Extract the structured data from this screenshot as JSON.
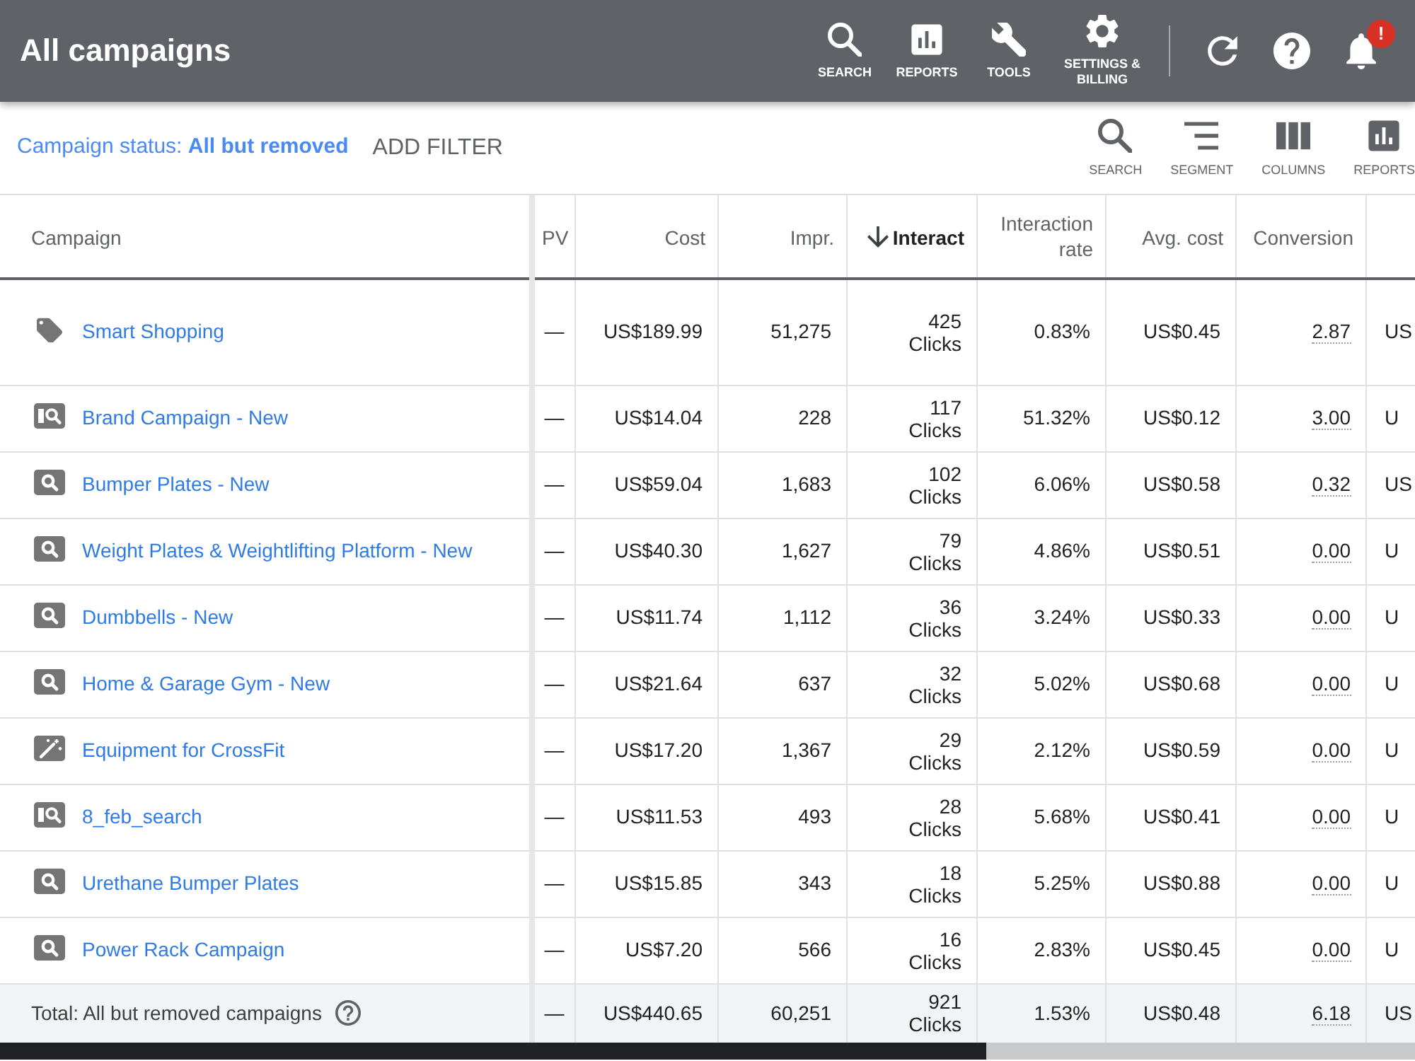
{
  "header": {
    "title": "All campaigns",
    "tools": [
      {
        "kind": "search",
        "label": "SEARCH"
      },
      {
        "kind": "reports",
        "label": "REPORTS"
      },
      {
        "kind": "tools",
        "label": "TOOLS"
      },
      {
        "kind": "settings",
        "label": "SETTINGS & BILLING"
      }
    ],
    "actions": [
      {
        "kind": "refresh"
      },
      {
        "kind": "help"
      },
      {
        "kind": "notifications",
        "badge": "!"
      }
    ]
  },
  "filter_bar": {
    "status_filter": "Campaign status: **All but removed**",
    "add_filter": "ADD FILTER",
    "tools": [
      {
        "kind": "search",
        "label": "SEARCH"
      },
      {
        "kind": "segment",
        "label": "SEGMENT"
      },
      {
        "kind": "columns",
        "label": "COLUMNS"
      },
      {
        "kind": "reports",
        "label": "REPORTS"
      }
    ]
  },
  "table": {
    "columns": [
      {
        "label": "Campaign",
        "sorted": false
      },
      {
        "label": "PV",
        "sorted": false
      },
      {
        "label": "Cost",
        "sorted": false
      },
      {
        "label": "Impr.",
        "sorted": false
      },
      {
        "label": "Interact",
        "sorted": true
      },
      {
        "label": "Interaction rate",
        "sorted": false
      },
      {
        "label": "Avg. cost",
        "sorted": false
      },
      {
        "label": "Conversion",
        "sorted": false
      }
    ],
    "rows": [
      {
        "kind": "shopping",
        "campaign": "Smart Shopping",
        "column_2": "—",
        "cost": "US$189.99",
        "impressions": "51,275",
        "interactions": "425",
        "interaction_unit": "Clicks",
        "interaction_rate": "0.83%",
        "avg_cost": "US$0.45",
        "conversions": "2.87",
        "column_9": "US"
      },
      {
        "kind": "display",
        "campaign": "Brand Campaign - New",
        "column_2": "—",
        "cost": "US$14.04",
        "impressions": "228",
        "interactions": "117",
        "interaction_unit": "Clicks",
        "interaction_rate": "51.32%",
        "avg_cost": "US$0.12",
        "conversions": "3.00",
        "column_9": "U"
      },
      {
        "kind": "search",
        "campaign": "Bumper Plates - New",
        "column_2": "—",
        "cost": "US$59.04",
        "impressions": "1,683",
        "interactions": "102",
        "interaction_unit": "Clicks",
        "interaction_rate": "6.06%",
        "avg_cost": "US$0.58",
        "conversions": "0.32",
        "column_9": "US"
      },
      {
        "kind": "search",
        "campaign": "Weight Plates & Weightlifting Platform - New",
        "column_2": "—",
        "cost": "US$40.30",
        "impressions": "1,627",
        "interactions": "79",
        "interaction_unit": "Clicks",
        "interaction_rate": "4.86%",
        "avg_cost": "US$0.51",
        "conversions": "0.00",
        "column_9": "U"
      },
      {
        "kind": "search",
        "campaign": "Dumbbells - New",
        "column_2": "—",
        "cost": "US$11.74",
        "impressions": "1,112",
        "interactions": "36",
        "interaction_unit": "Clicks",
        "interaction_rate": "3.24%",
        "avg_cost": "US$0.33",
        "conversions": "0.00",
        "column_9": "U"
      },
      {
        "kind": "search",
        "campaign": "Home & Garage Gym - New",
        "column_2": "—",
        "cost": "US$21.64",
        "impressions": "637",
        "interactions": "32",
        "interaction_unit": "Clicks",
        "interaction_rate": "5.02%",
        "avg_cost": "US$0.68",
        "conversions": "0.00",
        "column_9": "U"
      },
      {
        "kind": "smart",
        "campaign": "Equipment for CrossFit",
        "column_2": "—",
        "cost": "US$17.20",
        "impressions": "1,367",
        "interactions": "29",
        "interaction_unit": "Clicks",
        "interaction_rate": "2.12%",
        "avg_cost": "US$0.59",
        "conversions": "0.00",
        "column_9": "U"
      },
      {
        "kind": "display",
        "campaign": "8_feb_search",
        "column_2": "—",
        "cost": "US$11.53",
        "impressions": "493",
        "interactions": "28",
        "interaction_unit": "Clicks",
        "interaction_rate": "5.68%",
        "avg_cost": "US$0.41",
        "conversions": "0.00",
        "column_9": "U"
      },
      {
        "kind": "search",
        "campaign": "Urethane Bumper Plates",
        "column_2": "—",
        "cost": "US$15.85",
        "impressions": "343",
        "interactions": "18",
        "interaction_unit": "Clicks",
        "interaction_rate": "5.25%",
        "avg_cost": "US$0.88",
        "conversions": "0.00",
        "column_9": "U"
      },
      {
        "kind": "search",
        "campaign": "Power Rack Campaign",
        "column_2": "—",
        "cost": "US$7.20",
        "impressions": "566",
        "interactions": "16",
        "interaction_unit": "Clicks",
        "interaction_rate": "2.83%",
        "avg_cost": "US$0.45",
        "conversions": "0.00",
        "column_9": "U"
      }
    ],
    "total": {
      "label": "Total: All but removed campaigns",
      "column_2": "—",
      "cost": "US$440.65",
      "impressions": "60,251",
      "interactions": "921",
      "interaction_unit": "Clicks",
      "interaction_rate": "1.53%",
      "avg_cost": "US$0.48",
      "conversions": "6.18",
      "column_9": "US"
    }
  }
}
